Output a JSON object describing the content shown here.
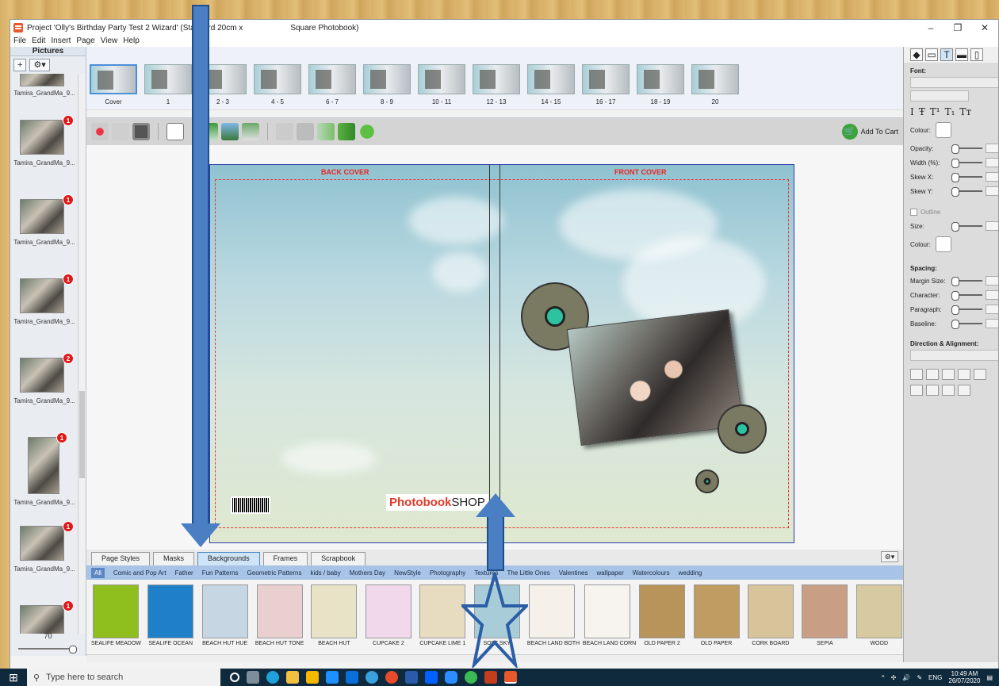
{
  "window": {
    "title": "Project 'Olly's Birthday Party Test 2 Wizard' (Standard 20cm x",
    "title_tail": "Square Photobook)",
    "controls": [
      "–",
      "❐",
      "✕"
    ]
  },
  "menu": [
    "File",
    "Edit",
    "Insert",
    "Page",
    "View",
    "Help"
  ],
  "pictures_panel": {
    "header": "Pictures",
    "add_label": "+",
    "gear_label": "⚙▾",
    "items": [
      {
        "label": "Tamira_GrandMa_9...",
        "badge": ""
      },
      {
        "label": "Tamira_GrandMa_9...",
        "badge": "1"
      },
      {
        "label": "Tamira_GrandMa_9...",
        "badge": "1"
      },
      {
        "label": "Tamira_GrandMa_9...",
        "badge": "1"
      },
      {
        "label": "Tamira_GrandMa_9...",
        "badge": "2"
      },
      {
        "label": "Tamira_GrandMa_9...",
        "badge": "1"
      },
      {
        "label": "Tamira_GrandMa_9...",
        "badge": "1"
      },
      {
        "label": "",
        "badge": "1"
      }
    ],
    "count": "70"
  },
  "page_strip": {
    "spreads": [
      "Cover",
      "1",
      "2 - 3",
      "4 - 5",
      "6 - 7",
      "8 - 9",
      "10 - 11",
      "12 - 13",
      "14 - 15",
      "16 - 17",
      "18 - 19",
      "20"
    ]
  },
  "toolbar": {
    "add_to_cart": "Add To Cart"
  },
  "canvas": {
    "back_cover": "BACK COVER",
    "front_cover": "FRONT COVER",
    "logo_bold": "Photobook",
    "logo_rest": "SHOP"
  },
  "library": {
    "tabs": [
      "Page Styles",
      "Masks",
      "Backgrounds",
      "Frames",
      "Scrapbook"
    ],
    "active_tab": "Backgrounds",
    "categories": [
      "All",
      "Comic and Pop Art",
      "Father",
      "Fun Patterns",
      "Geometric Patterns",
      "kids / baby",
      "Mothers Day",
      "NewStyle",
      "Photography",
      "Textures",
      "The Little Ones",
      "Valentines",
      "wallpaper",
      "Watercolours",
      "wedding"
    ],
    "backgrounds": [
      {
        "name": "SEALIFE MEADOW",
        "color": "#8fbf1e"
      },
      {
        "name": "SEALIFE OCEAN",
        "color": "#1f7fc8"
      },
      {
        "name": "BEACH HUT HUE",
        "color": "#c7d6e3"
      },
      {
        "name": "BEACH HUT TONE",
        "color": "#e9cfd0"
      },
      {
        "name": "BEACH HUT",
        "color": "#e8e2c6"
      },
      {
        "name": "CUPCAKE 2",
        "color": "#f1d8ea"
      },
      {
        "name": "CUPCAKE LIME 1",
        "color": "#e8dcc0"
      },
      {
        "name": "SOFT SKY",
        "color": "#a9cdd8"
      },
      {
        "name": "BEACH LAND BOTH",
        "color": "#f5f0ea"
      },
      {
        "name": "BEACH LAND CORN",
        "color": "#f7f4ef"
      },
      {
        "name": "OLD PAPER 2",
        "color": "#b8935a"
      },
      {
        "name": "OLD PAPER",
        "color": "#bf9c62"
      },
      {
        "name": "CORK BOARD",
        "color": "#d8c49a"
      },
      {
        "name": "SEPIA",
        "color": "#c89e85"
      },
      {
        "name": "WOOD",
        "color": "#d7c9a0"
      }
    ]
  },
  "right_panel": {
    "font_label": "Font:",
    "format_glyphs": [
      "I",
      "Ŧ",
      "T¹",
      "T₁",
      "Tт"
    ],
    "colour_label": "Colour:",
    "sliders": [
      "Opacity:",
      "Width (%):",
      "Skew X:",
      "Skew Y:"
    ],
    "outline_label": "Outline",
    "size_label": "Size:",
    "colour2_label": "Colour:",
    "spacing_label": "Spacing:",
    "spacing_rows": [
      "Margin Size:",
      "Character:",
      "Paragraph:",
      "Baseline:"
    ],
    "direction_label": "Direction & Alignment:"
  },
  "taskbar": {
    "search_placeholder": "Type here to search",
    "lang": "ENG",
    "time": "10:49 AM",
    "date": "26/07/2020"
  }
}
